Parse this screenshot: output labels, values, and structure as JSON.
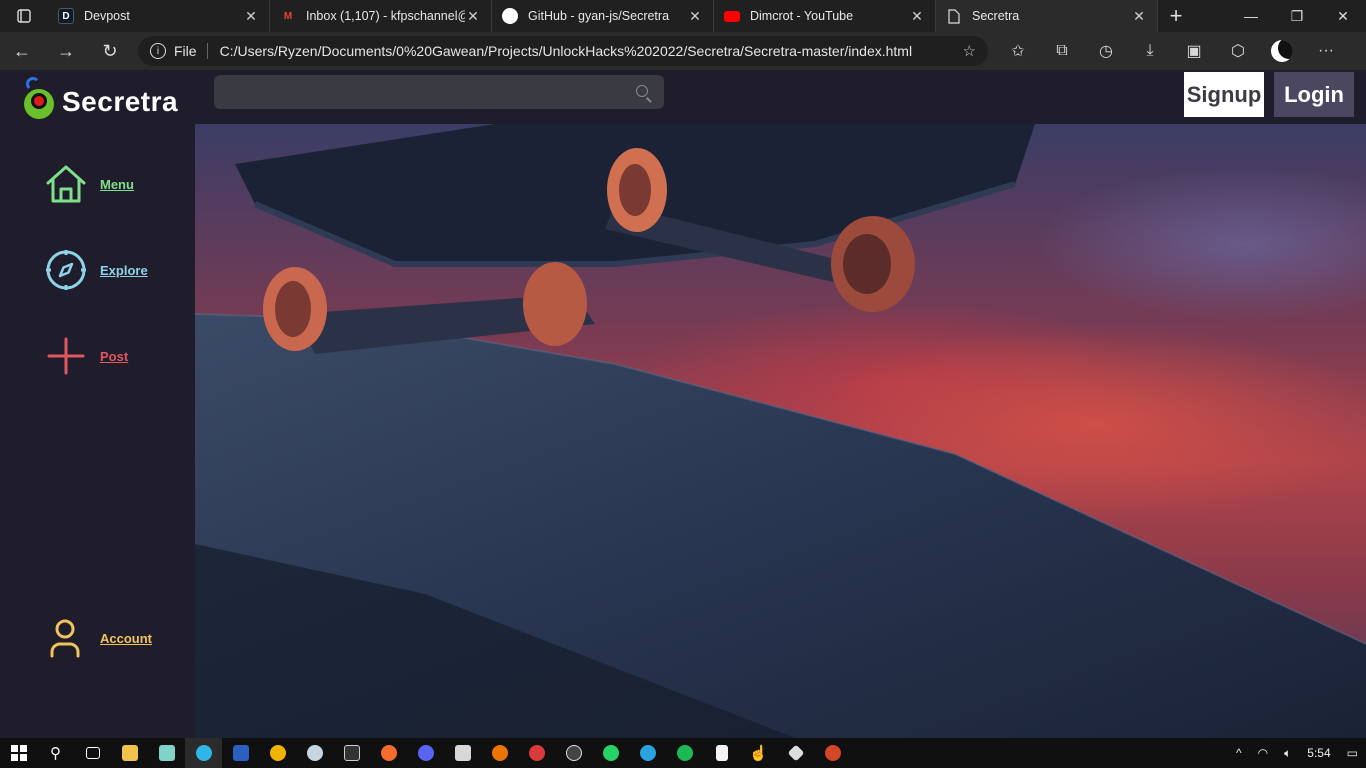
{
  "browser": {
    "tabs": [
      {
        "title": "Devpost",
        "favicon": "D",
        "color": "#0b1c2c",
        "icon": "devpost-icon"
      },
      {
        "title": "Inbox (1,107) - kfpschannel@",
        "favicon": "M",
        "color": "#ffffff",
        "icon": "gmail-icon"
      },
      {
        "title": "GitHub - gyan-js/Secretra",
        "favicon": "",
        "color": "#ffffff",
        "icon": "github-icon"
      },
      {
        "title": "Dimcrot - YouTube",
        "favicon": "",
        "color": "#ff0000",
        "icon": "youtube-icon"
      },
      {
        "title": "Secretra",
        "favicon": "",
        "color": "#dddddd",
        "icon": "page-icon"
      }
    ],
    "active_tab": 4,
    "address": {
      "scheme": "File",
      "url": "C:/Users/Ryzen/Documents/0%20Gawean/Projects/UnlockHacks%202022/Secretra/Secretra-master/index.html"
    }
  },
  "site": {
    "logo_text": "Secretra",
    "search_placeholder": "",
    "signup_label": "Signup",
    "login_label": "Login",
    "nav": [
      {
        "label": "Menu",
        "icon": "home-icon",
        "color": "#7ee08a"
      },
      {
        "label": "Explore",
        "icon": "compass-icon",
        "color": "#8fd3e8"
      },
      {
        "label": "Post",
        "icon": "plus-icon",
        "color": "#e0575e"
      },
      {
        "label": "Account",
        "icon": "user-icon",
        "color": "#f0c45a"
      }
    ]
  },
  "taskbar": {
    "time": "5:54"
  }
}
